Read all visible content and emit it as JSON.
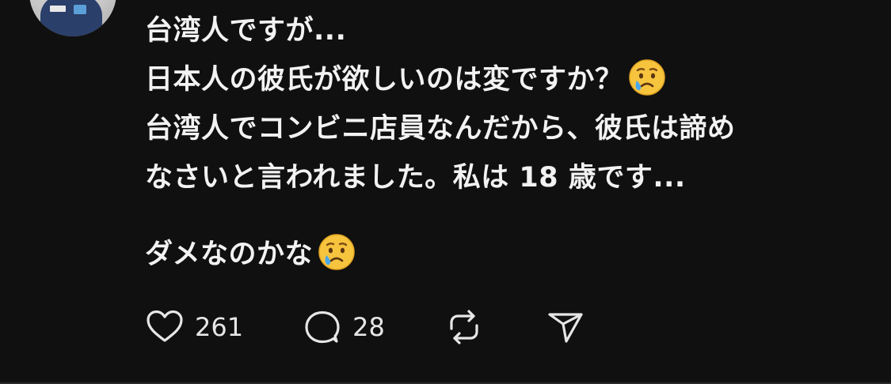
{
  "post": {
    "lines": [
      "台湾人ですが...",
      "日本人の彼氏が欲しいのは変ですか？",
      "台湾人でコンビニ店員なんだから、彼氏は諦め",
      "なさいと言われました。私は 18 歳です...",
      "ダメなのかな"
    ],
    "emoji": "crying-face"
  },
  "actions": {
    "like": {
      "icon": "heart-icon",
      "count": "261"
    },
    "reply": {
      "icon": "speech-bubble-icon",
      "count": "28"
    },
    "repost": {
      "icon": "repost-icon"
    },
    "share": {
      "icon": "send-icon"
    }
  },
  "colors": {
    "background": "#101010",
    "text": "#f2f2f2",
    "icon": "#e6e6e6"
  }
}
